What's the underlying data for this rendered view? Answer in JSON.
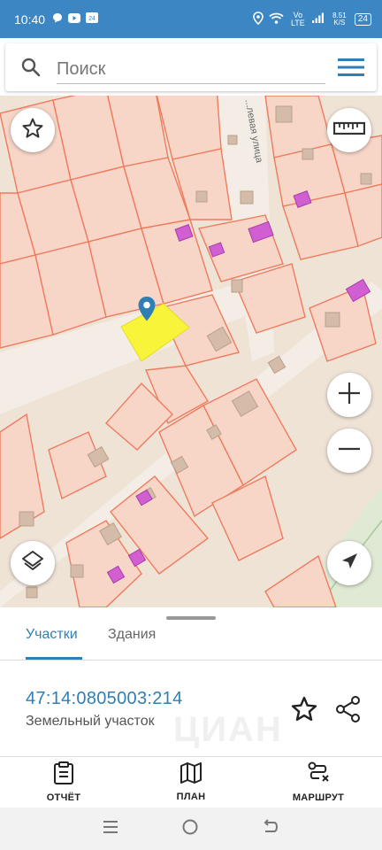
{
  "status_bar": {
    "time": "10:40",
    "network": "Vo LTE",
    "speed": "8.51 K/S",
    "battery": "24"
  },
  "search": {
    "placeholder": "Поиск",
    "icon": "search-icon",
    "menu_icon": "hamburger-menu-icon"
  },
  "map": {
    "street_label": "...левая улица",
    "colors": {
      "background": "#efe3d6",
      "parcel_fill": "#f7d6c8",
      "parcel_stroke": "#ef7b5e",
      "building": "#d4bca9",
      "registered_building": "#d15fd1",
      "selected_plot": "#f8f43a",
      "marker": "#2f7fb5",
      "road": "#f3ede6",
      "greenery": "#dfe9d4"
    },
    "buttons": {
      "favorite": "star-icon",
      "ruler": "ruler-icon",
      "zoom_in": "plus-icon",
      "zoom_out": "minus-icon",
      "layers": "layers-icon",
      "locate": "navigation-arrow-icon"
    }
  },
  "sheet": {
    "tabs": [
      {
        "label": "Участки",
        "active": true
      },
      {
        "label": "Здания",
        "active": false
      }
    ],
    "cadastral_number": "47:14:0805003:214",
    "plot_type": "Земельный участок",
    "watermark": "ЦИАН"
  },
  "bottom_nav": {
    "items": [
      {
        "label": "ОТЧЁТ",
        "icon": "report-clipboard-icon"
      },
      {
        "label": "ПЛАН",
        "icon": "map-icon"
      },
      {
        "label": "МАРШРУТ",
        "icon": "route-icon"
      }
    ]
  },
  "system_nav": {
    "items": [
      "recents-icon",
      "home-icon",
      "back-icon"
    ]
  }
}
